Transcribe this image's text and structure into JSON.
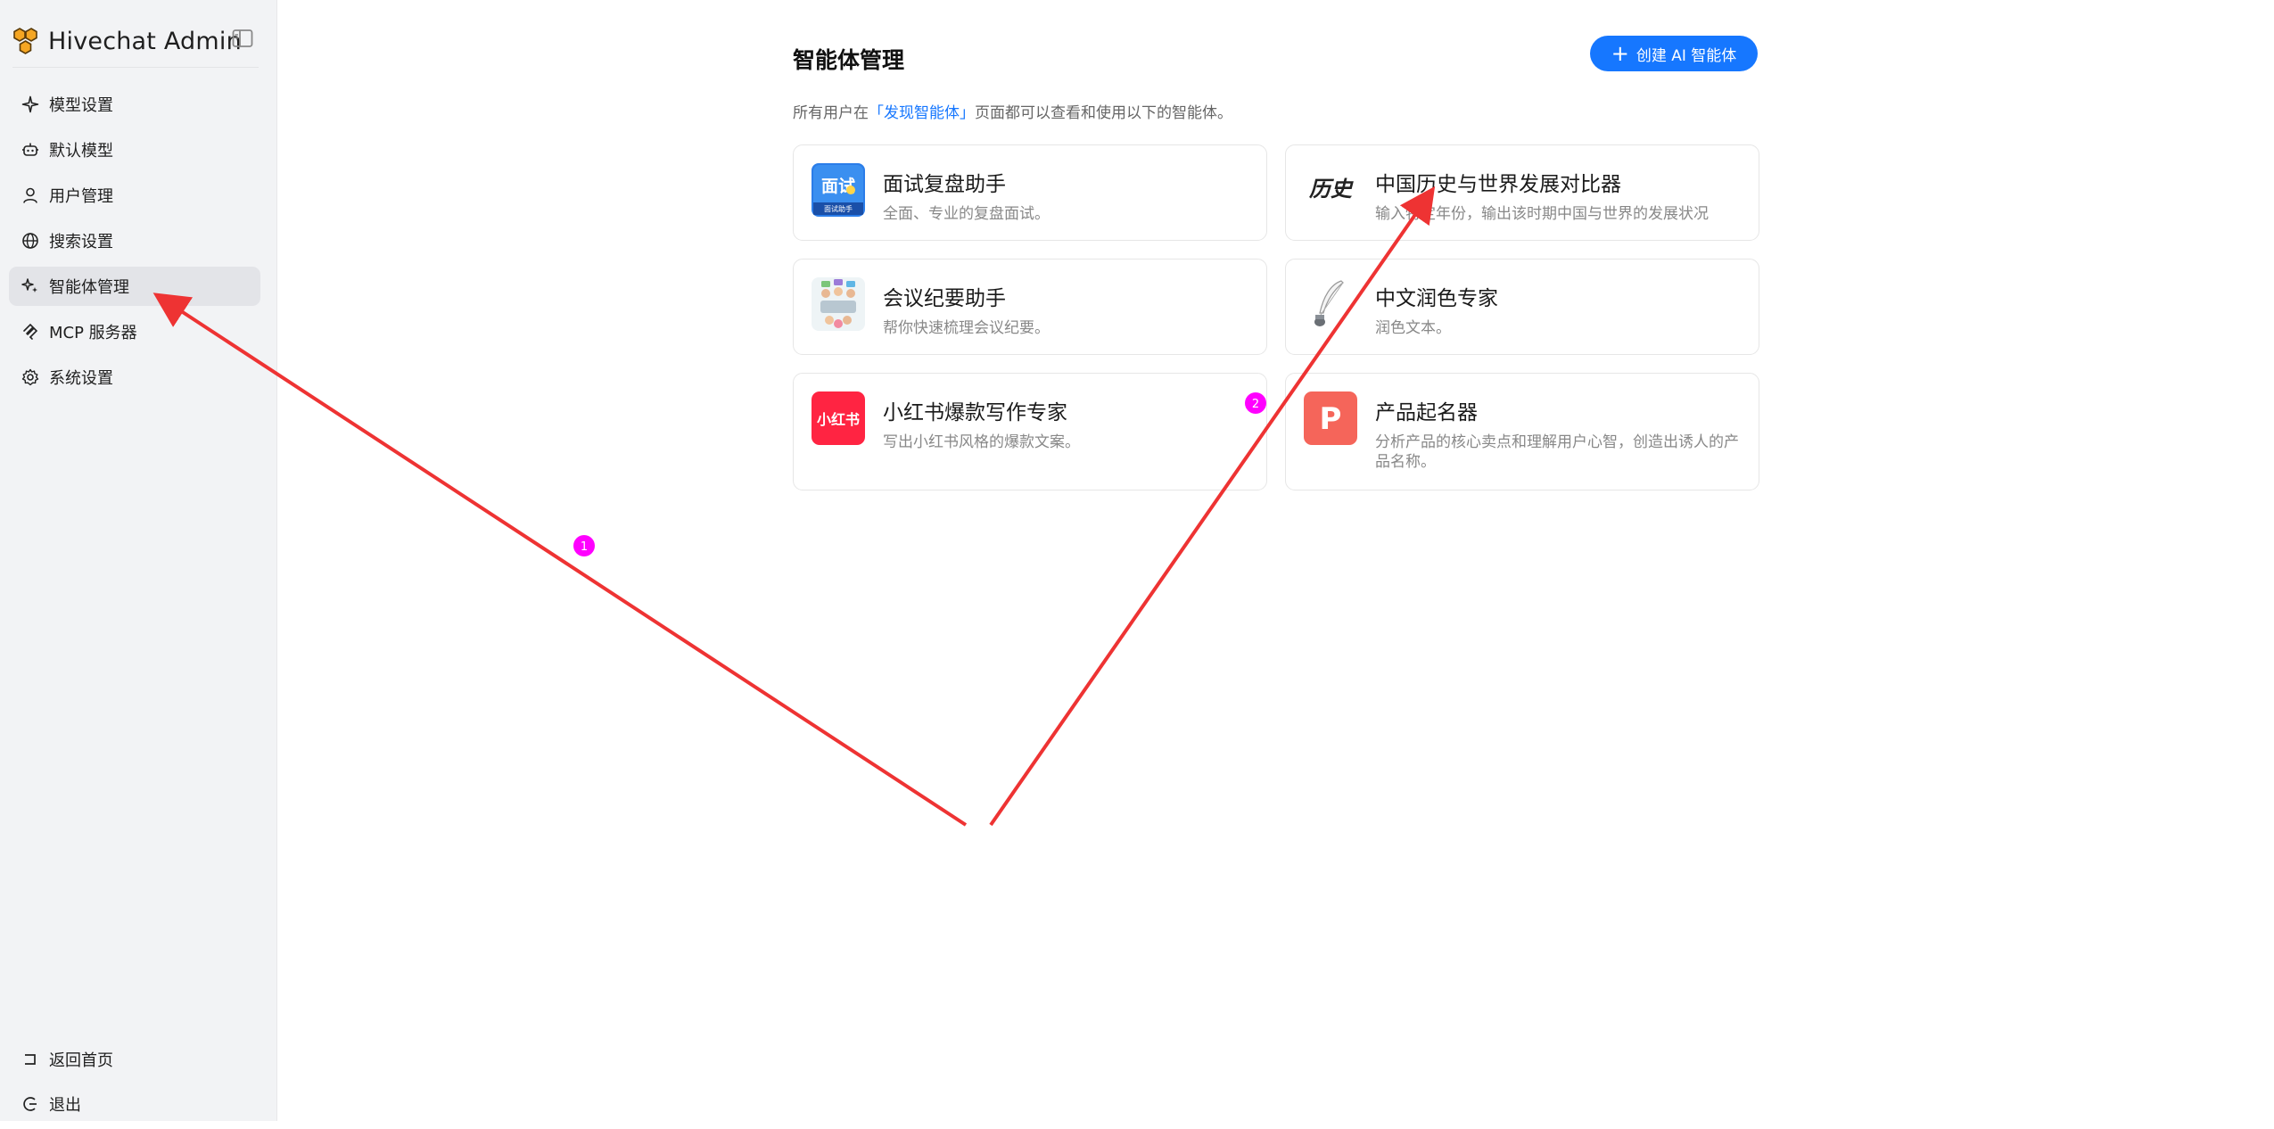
{
  "brand": {
    "title": "Hivechat Admin"
  },
  "nav": {
    "items": [
      {
        "label": "模型设置",
        "icon": "sparkle-icon"
      },
      {
        "label": "默认模型",
        "icon": "bot-icon"
      },
      {
        "label": "用户管理",
        "icon": "user-icon"
      },
      {
        "label": "搜索设置",
        "icon": "globe-icon"
      },
      {
        "label": "智能体管理",
        "icon": "sparkles-icon",
        "active": true
      },
      {
        "label": "MCP 服务器",
        "icon": "mcp-icon"
      },
      {
        "label": "系统设置",
        "icon": "gear-icon"
      }
    ],
    "bottom": [
      {
        "label": "返回首页",
        "icon": "return-icon"
      },
      {
        "label": "退出",
        "icon": "logout-icon"
      }
    ]
  },
  "main": {
    "title": "智能体管理",
    "create_button": "创建 AI 智能体",
    "subtitle_prefix": "所有用户在",
    "subtitle_link": "「发现智能体」",
    "subtitle_suffix": "页面都可以查看和使用以下的智能体。",
    "agents": [
      {
        "title": "面试复盘助手",
        "desc": "全面、专业的复盘面试。",
        "avatar": "interview-avatar",
        "avatar_text": "面试",
        "avatar_sub": "面试助手"
      },
      {
        "title": "中国历史与世界发展对比器",
        "desc": "输入特定年份，输出该时期中国与世界的发展状况",
        "avatar": "history-avatar",
        "avatar_text": "历史"
      },
      {
        "title": "会议纪要助手",
        "desc": "帮你快速梳理会议纪要。",
        "avatar": "meeting-avatar"
      },
      {
        "title": "中文润色专家",
        "desc": "润色文本。",
        "avatar": "quill-avatar"
      },
      {
        "title": "小红书爆款写作专家",
        "desc": "写出小红书风格的爆款文案。",
        "avatar": "xiaohongshu-avatar",
        "avatar_text": "小红书"
      },
      {
        "title": "产品起名器",
        "desc": "分析产品的核心卖点和理解用户心智，创造出诱人的产品名称。",
        "avatar": "product-namer-avatar",
        "avatar_text": "P"
      }
    ]
  },
  "annotations": [
    {
      "label": "1",
      "color": "#ff00ff"
    },
    {
      "label": "2",
      "color": "#ff00ff"
    }
  ],
  "colors": {
    "accent": "#1677ff",
    "arrow": "#ee3333",
    "sidebar_bg": "#f2f3f5",
    "active_item_bg": "#e3e4e8"
  }
}
